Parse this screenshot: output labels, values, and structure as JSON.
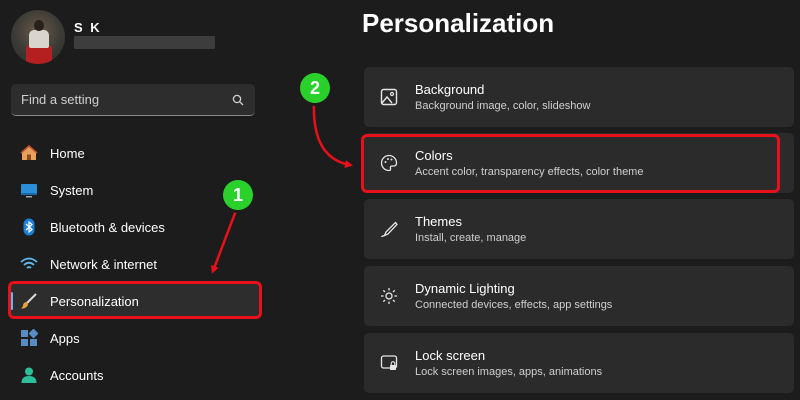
{
  "user": {
    "name": "S K"
  },
  "search": {
    "placeholder": "Find a setting"
  },
  "sidebar": {
    "items": [
      {
        "label": "Home",
        "icon": "home-icon"
      },
      {
        "label": "System",
        "icon": "monitor-icon"
      },
      {
        "label": "Bluetooth & devices",
        "icon": "bluetooth-icon"
      },
      {
        "label": "Network & internet",
        "icon": "wifi-icon"
      },
      {
        "label": "Personalization",
        "icon": "brush-icon",
        "active": true
      },
      {
        "label": "Apps",
        "icon": "apps-icon"
      },
      {
        "label": "Accounts",
        "icon": "account-icon"
      }
    ]
  },
  "main": {
    "title": "Personalization",
    "cards": [
      {
        "title": "Background",
        "desc": "Background image, color, slideshow",
        "icon": "image-icon"
      },
      {
        "title": "Colors",
        "desc": "Accent color, transparency effects, color theme",
        "icon": "palette-icon"
      },
      {
        "title": "Themes",
        "desc": "Install, create, manage",
        "icon": "pen-icon"
      },
      {
        "title": "Dynamic Lighting",
        "desc": "Connected devices, effects, app settings",
        "icon": "lighting-icon"
      },
      {
        "title": "Lock screen",
        "desc": "Lock screen images, apps, animations",
        "icon": "lock-screen-icon"
      }
    ]
  },
  "annotations": {
    "step1": "1",
    "step2": "2",
    "highlight_color": "#e8101a",
    "badge_color": "#2bd12b"
  },
  "colors": {
    "accent": "#4cc2ff",
    "background": "#1c1c1c",
    "card": "#2b2b2b"
  }
}
